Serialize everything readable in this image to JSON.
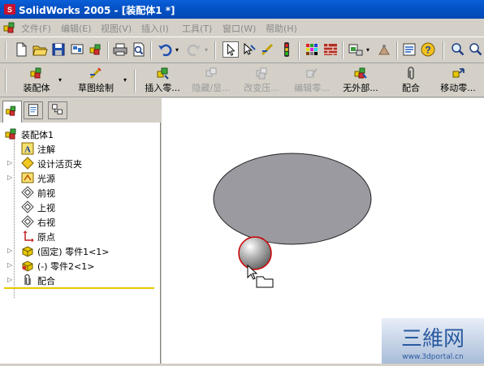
{
  "window": {
    "title": "SolidWorks 2005 - [装配体1 *]"
  },
  "menu": {
    "items": [
      "文件(F)",
      "编辑(E)",
      "视图(V)",
      "插入(I)",
      "工具(T)",
      "窗口(W)",
      "帮助(H)"
    ]
  },
  "commands": [
    {
      "label": "装配体",
      "enabled": true,
      "has_dropdown": true
    },
    {
      "label": "草图绘制",
      "enabled": true,
      "has_dropdown": true
    },
    {
      "label": "插入零...",
      "enabled": true
    },
    {
      "label": "隐藏/显...",
      "enabled": false
    },
    {
      "label": "改变压...",
      "enabled": false
    },
    {
      "label": "编辑零...",
      "enabled": false
    },
    {
      "label": "无外部...",
      "enabled": true
    },
    {
      "label": "配合",
      "enabled": true
    },
    {
      "label": "移动零...",
      "enabled": true
    }
  ],
  "tree": {
    "root": "装配体1",
    "items": [
      {
        "label": "注解",
        "icon": "annotation-icon",
        "expandable": false
      },
      {
        "label": "设计活页夹",
        "icon": "design-binder-icon",
        "expandable": true
      },
      {
        "label": "光源",
        "icon": "lighting-icon",
        "expandable": true
      },
      {
        "label": "前视",
        "icon": "plane-icon",
        "expandable": false
      },
      {
        "label": "上视",
        "icon": "plane-icon",
        "expandable": false
      },
      {
        "label": "右视",
        "icon": "plane-icon",
        "expandable": false
      },
      {
        "label": "原点",
        "icon": "origin-icon",
        "expandable": false
      },
      {
        "label": "(固定) 零件1<1>",
        "icon": "part-icon",
        "expandable": true
      },
      {
        "label": "(-) 零件2<1>",
        "icon": "part-icon",
        "expandable": true
      },
      {
        "label": "配合",
        "icon": "mates-icon",
        "expandable": true
      }
    ]
  },
  "watermark": {
    "logo": "三維网",
    "url": "www.3dportal.cn"
  },
  "colors": {
    "titlebar": "#0553c7",
    "viewport": "#ffffff",
    "ellipse": "#9a9aa0",
    "sphere": "#b8b8b8",
    "sphere_outline": "#cc0000"
  }
}
